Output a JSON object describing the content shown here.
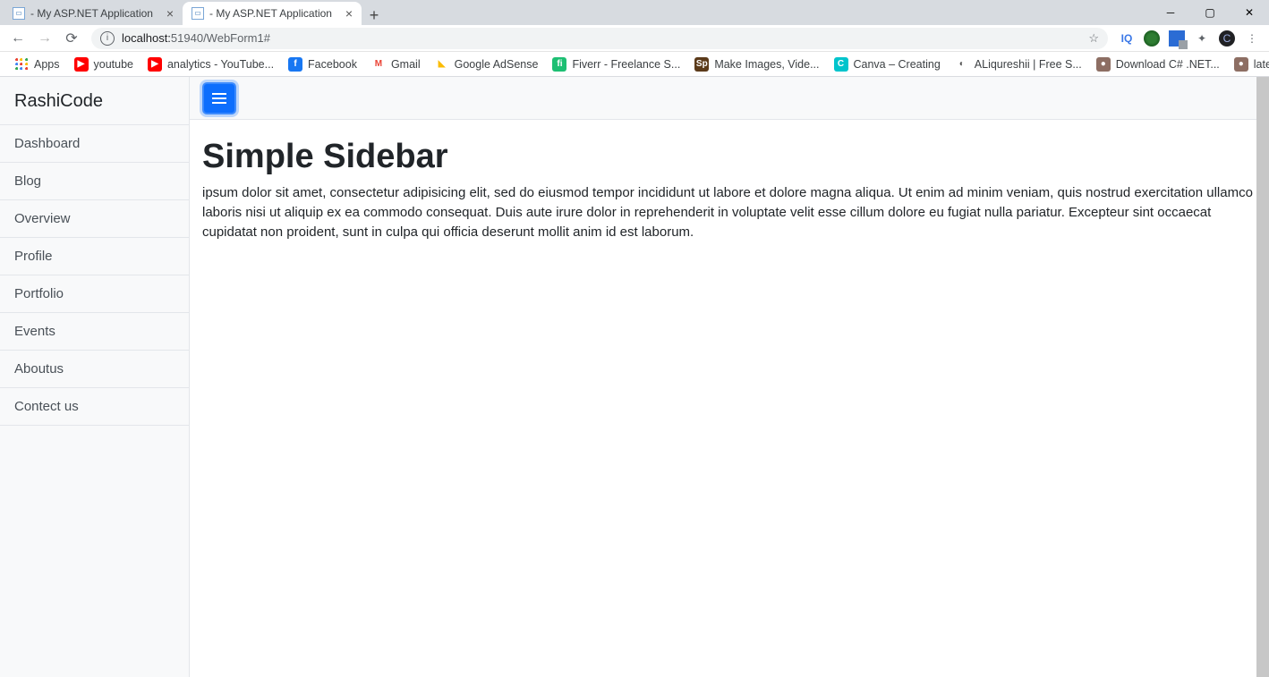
{
  "browser": {
    "tabs": [
      {
        "title": "- My ASP.NET Application",
        "active": false
      },
      {
        "title": "- My ASP.NET Application",
        "active": true
      }
    ],
    "url_host": "localhost:",
    "url_port_path": "51940/WebForm1#",
    "bookmarks": [
      {
        "label": "Apps",
        "icon_bg": "",
        "icon_text": "",
        "kind": "apps"
      },
      {
        "label": "youtube",
        "icon_bg": "#ff0000",
        "icon_text": "▶"
      },
      {
        "label": "analytics - YouTube...",
        "icon_bg": "#ff0000",
        "icon_text": "▶"
      },
      {
        "label": "Facebook",
        "icon_bg": "#1877f2",
        "icon_text": "f"
      },
      {
        "label": "Gmail",
        "icon_bg": "#ffffff",
        "icon_text": "M",
        "text_color": "#ea4335"
      },
      {
        "label": "Google AdSense",
        "icon_bg": "#fff",
        "icon_text": "◣",
        "text_color": "#fbbc05"
      },
      {
        "label": "Fiverr - Freelance S...",
        "icon_bg": "#1dbf73",
        "icon_text": "fi"
      },
      {
        "label": "Make Images, Vide...",
        "icon_bg": "#5b3a1a",
        "icon_text": "Sp"
      },
      {
        "label": "Canva – Creating",
        "icon_bg": "#00c4cc",
        "icon_text": "C"
      },
      {
        "label": "ALiqureshii | Free S...",
        "icon_bg": "#ffffff",
        "icon_text": "◐",
        "text_color": "#555"
      },
      {
        "label": "Download C# .NET...",
        "icon_bg": "#8d6e63",
        "icon_text": "●"
      },
      {
        "label": "latest C# .NET proje...",
        "icon_bg": "#8d6e63",
        "icon_text": "●"
      }
    ]
  },
  "sidebar": {
    "brand": "RashiCode",
    "items": [
      {
        "label": "Dashboard"
      },
      {
        "label": "Blog"
      },
      {
        "label": "Overview"
      },
      {
        "label": "Profile"
      },
      {
        "label": "Portfolio"
      },
      {
        "label": "Events"
      },
      {
        "label": "Aboutus"
      },
      {
        "label": "Contect us"
      }
    ]
  },
  "content": {
    "heading": "Simple Sidebar",
    "paragraph": "ipsum dolor sit amet, consectetur adipisicing elit, sed do eiusmod tempor incididunt ut labore et dolore magna aliqua. Ut enim ad minim veniam, quis nostrud exercitation ullamco laboris nisi ut aliquip ex ea commodo consequat. Duis aute irure dolor in reprehenderit in voluptate velit esse cillum dolore eu fugiat nulla pariatur. Excepteur sint occaecat cupidatat non proident, sunt in culpa qui officia deserunt mollit anim id est laborum."
  }
}
